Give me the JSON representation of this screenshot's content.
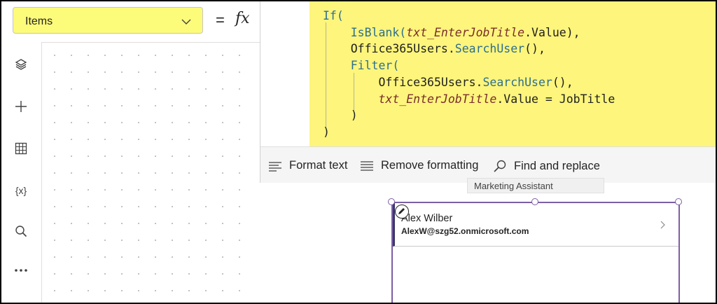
{
  "formula_bar": {
    "property": "Items",
    "equals": "=",
    "fx": "fx",
    "copilot_icon": "copilot-icon"
  },
  "formula": {
    "lines": [
      "If(",
      "IsBlank(txt_EnterJobTitle.Value),",
      "Office365Users.SearchUser(),",
      "Filter(",
      "Office365Users.SearchUser(),",
      "txt_EnterJobTitle.Value = JobTitle",
      ")",
      ")"
    ]
  },
  "command_bar": {
    "format_text": "Format text",
    "remove_formatting": "Remove formatting",
    "find_replace": "Find and replace"
  },
  "left_rail": {
    "items": [
      "layers-icon",
      "add-icon",
      "table-icon",
      "variables-icon",
      "search-icon",
      "more-icon"
    ],
    "variables_glyph": "{x}"
  },
  "gallery": {
    "tooltip": "Marketing Assistant",
    "items": [
      {
        "name": "Alex Wilber",
        "email": "AlexW@szg52.onmicrosoft.com"
      }
    ]
  },
  "colors": {
    "highlight": "#fdf57c",
    "selection": "#7c5fa6"
  }
}
